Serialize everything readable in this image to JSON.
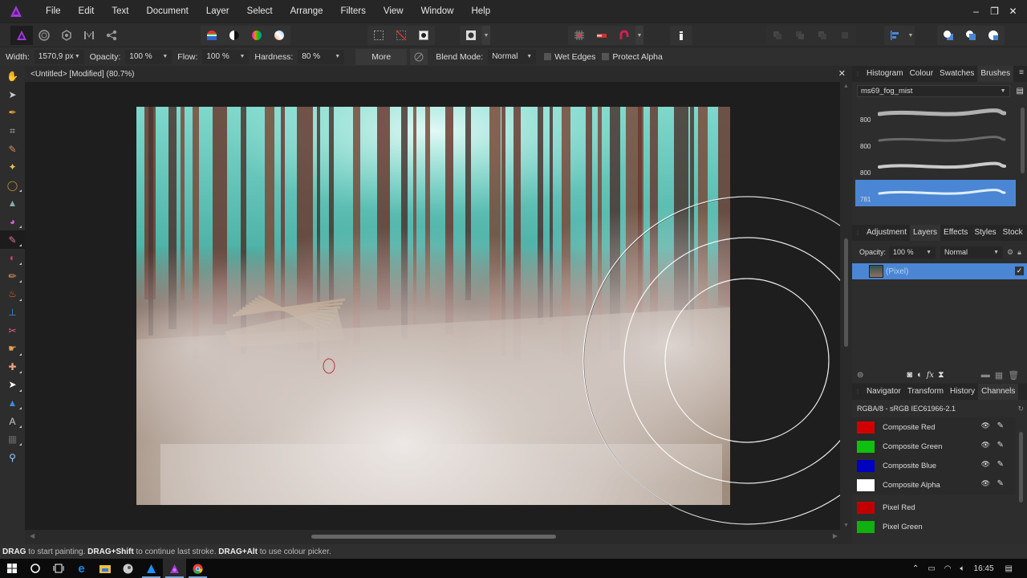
{
  "app": {
    "name": "Affinity Photo",
    "accent": "#4a86d4"
  },
  "menu": [
    "File",
    "Edit",
    "Text",
    "Document",
    "Layer",
    "Select",
    "Arrange",
    "Filters",
    "View",
    "Window",
    "Help"
  ],
  "window_controls": {
    "minimize": "–",
    "restore": "❐",
    "close": "✕"
  },
  "toolbar": {
    "personas": [
      "photo-persona-icon",
      "liquify-persona-icon",
      "develop-persona-icon",
      "tone-mapping-persona-icon",
      "export-persona-icon"
    ],
    "adjust": [
      "levels-icon",
      "contrast-icon",
      "colour-wheel-icon",
      "white-balance-icon"
    ],
    "selection": [
      "marquee-icon",
      "deselect-icon",
      "quick-mask-icon"
    ],
    "snapping": [
      "grid-icon",
      "snap-to-icon",
      "magnet-icon"
    ]
  },
  "context": {
    "width_label": "Width:",
    "width_value": "1570,9 px",
    "opacity_label": "Opacity:",
    "opacity_value": "100 %",
    "flow_label": "Flow:",
    "flow_value": "100 %",
    "hardness_label": "Hardness:",
    "hardness_value": "80 %",
    "more_label": "More",
    "blend_label": "Blend Mode:",
    "blend_value": "Normal",
    "wet_edges_label": "Wet Edges",
    "protect_alpha_label": "Protect Alpha"
  },
  "tools": [
    {
      "name": "view-tool"
    },
    {
      "name": "move-tool"
    },
    {
      "name": "colour-picker-tool"
    },
    {
      "name": "crop-tool"
    },
    {
      "name": "selection-brush-tool"
    },
    {
      "name": "flood-select-tool"
    },
    {
      "name": "freehand-selection-tool"
    },
    {
      "name": "flood-fill-tool"
    },
    {
      "name": "colour-replacement-tool"
    },
    {
      "name": "paint-brush-tool",
      "active": true
    },
    {
      "name": "pixel-tool"
    },
    {
      "name": "erase-brush-tool"
    },
    {
      "name": "dodge-brush-tool"
    },
    {
      "name": "clone-brush-tool"
    },
    {
      "name": "blemish-tool"
    },
    {
      "name": "smudge-brush-tool"
    },
    {
      "name": "red-eye-tool"
    },
    {
      "name": "node-tool"
    },
    {
      "name": "shape-tool"
    },
    {
      "name": "text-tool"
    },
    {
      "name": "mesh-warp-tool"
    },
    {
      "name": "zoom-tool"
    }
  ],
  "document": {
    "title": "<Untitled> [Modified] (80.7%)",
    "close": "✕"
  },
  "brushes_panel": {
    "tabs": [
      "Histogram",
      "Colour",
      "Swatches",
      "Brushes"
    ],
    "active_tab": "Brushes",
    "category": "ms69_fog_mist",
    "brushes": [
      {
        "size": "800",
        "selected": false
      },
      {
        "size": "800",
        "selected": false
      },
      {
        "size": "800",
        "selected": false
      },
      {
        "size": "781",
        "selected": true
      }
    ]
  },
  "layers_panel": {
    "tabs": [
      "Adjustment",
      "Layers",
      "Effects",
      "Styles",
      "Stock"
    ],
    "active_tab": "Layers",
    "opacity_label": "Opacity:",
    "opacity_value": "100 %",
    "blend_mode": "Normal",
    "layers": [
      {
        "name": "(Pixel)",
        "visible": true,
        "selected": true
      }
    ]
  },
  "channels_panel": {
    "tabs": [
      "Navigator",
      "Transform",
      "History",
      "Channels"
    ],
    "active_tab": "Channels",
    "format": "RGBA/8 - sRGB IEC61966-2.1",
    "channels": [
      {
        "name": "Composite Red",
        "color": "#d00000",
        "group": "composite"
      },
      {
        "name": "Composite Green",
        "color": "#10c010",
        "group": "composite"
      },
      {
        "name": "Composite Blue",
        "color": "#0000c0",
        "group": "composite"
      },
      {
        "name": "Composite Alpha",
        "color": "#ffffff",
        "group": "composite"
      },
      {
        "name": "Pixel Red",
        "color": "#c00000",
        "group": "pixel"
      },
      {
        "name": "Pixel Green",
        "color": "#10b010",
        "group": "pixel"
      }
    ]
  },
  "status": {
    "k1": "DRAG",
    "t1": " to start painting. ",
    "k2": "DRAG+Shift",
    "t2": " to continue last stroke. ",
    "k3": "DRAG+Alt",
    "t3": " to use colour picker."
  },
  "taskbar": {
    "apps": [
      "start-icon",
      "cortana-icon",
      "task-view-icon",
      "edge-icon",
      "file-explorer-icon",
      "steam-icon",
      "affinity-designer-icon",
      "affinity-photo-icon",
      "chrome-icon"
    ],
    "time": "16:45"
  }
}
